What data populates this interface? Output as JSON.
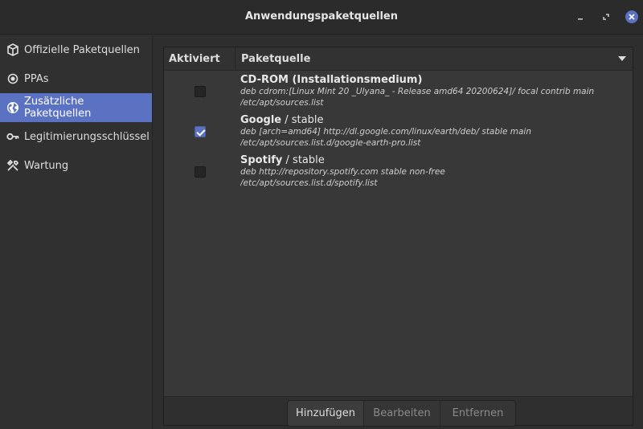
{
  "window": {
    "title": "Anwendungspaketquellen"
  },
  "sidebar": {
    "items": [
      {
        "label": "Offizielle Paketquellen",
        "icon": "package-icon"
      },
      {
        "label": "PPAs",
        "icon": "ppa-icon"
      },
      {
        "label": "Zusätzliche Paketquellen",
        "icon": "globe-icon",
        "active": true
      },
      {
        "label": "Legitimierungsschlüssel",
        "icon": "key-icon"
      },
      {
        "label": "Wartung",
        "icon": "tools-icon"
      }
    ]
  },
  "table": {
    "headers": {
      "enabled": "Aktiviert",
      "source": "Paketquelle"
    },
    "rows": [
      {
        "name": "CD-ROM (Installationsmedium)",
        "suffix": "",
        "checked": false,
        "line1": "deb cdrom:[Linux Mint 20 _Ulyana_ - Release amd64 20200624]/ focal contrib main",
        "line2": "/etc/apt/sources.list"
      },
      {
        "name": "Google",
        "suffix": " / stable",
        "checked": true,
        "line1": "deb [arch=amd64] http://dl.google.com/linux/earth/deb/ stable main",
        "line2": "/etc/apt/sources.list.d/google-earth-pro.list"
      },
      {
        "name": "Spotify",
        "suffix": " / stable",
        "checked": false,
        "line1": "deb http://repository.spotify.com stable non-free",
        "line2": "/etc/apt/sources.list.d/spotify.list"
      }
    ]
  },
  "actions": {
    "add": "Hinzufügen",
    "edit": "Bearbeiten",
    "remove": "Entfernen"
  },
  "colors": {
    "accent": "#5b72c2"
  }
}
